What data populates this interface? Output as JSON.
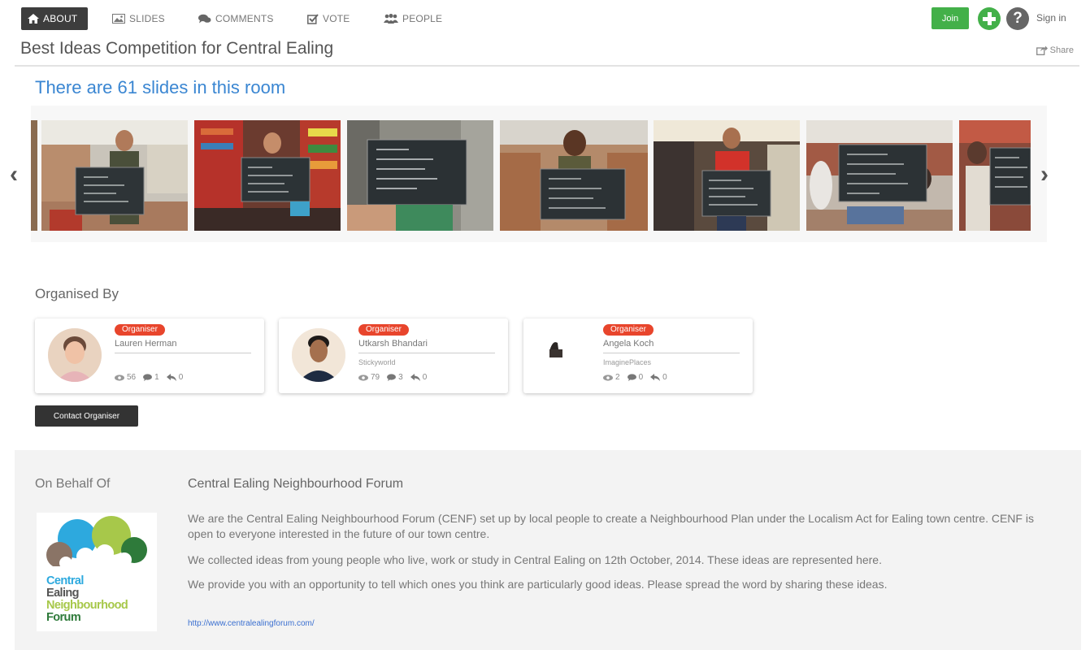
{
  "nav": {
    "tabs": [
      {
        "label": "ABOUT",
        "icon": "home-icon",
        "active": true
      },
      {
        "label": "SLIDES",
        "icon": "image-icon",
        "active": false
      },
      {
        "label": "COMMENTS",
        "icon": "comments-icon",
        "active": false
      },
      {
        "label": "VOTE",
        "icon": "checkbox-icon",
        "active": false
      },
      {
        "label": "PEOPLE",
        "icon": "people-icon",
        "active": false
      }
    ],
    "join_label": "Join",
    "help_glyph": "?",
    "signin_label": "Sign in"
  },
  "room": {
    "title": "Best Ideas Competition for Central Ealing",
    "share_label": "Share",
    "slides_count_text": "There are 61 slides in this room"
  },
  "carousel": {
    "prev_glyph": "‹",
    "next_glyph": "›"
  },
  "organised": {
    "heading": "Organised By",
    "cards": [
      {
        "badge": "Organiser",
        "name": "Lauren Herman",
        "affiliation": "",
        "views": "56",
        "comments": "1",
        "replies": "0"
      },
      {
        "badge": "Organiser",
        "name": "Utkarsh Bhandari",
        "affiliation": "Stickyworld",
        "views": "79",
        "comments": "3",
        "replies": "0"
      },
      {
        "badge": "Organiser",
        "name": "Angela Koch",
        "affiliation": "ImaginePlaces",
        "views": "2",
        "comments": "0",
        "replies": "0"
      }
    ],
    "contact_label": "Contact Organiser"
  },
  "behalf": {
    "label": "On Behalf Of",
    "logo_lines": [
      "Central",
      "Ealing",
      "Neighbourhood",
      "Forum"
    ],
    "forum_name": "Central Ealing Neighbourhood Forum",
    "paragraphs": [
      "We are the Central Ealing Neighbourhood Forum (CENF) set up by local people to create a Neighbourhood Plan under the Localism Act for Ealing town centre. CENF is open to everyone interested in the future of our town centre.",
      "We collected ideas from young people who live, work or study in Central Ealing on 12th October, 2014. These ideas are represented here.",
      "We provide you with an opportunity to tell which ones you think are particularly good ideas. Please spread the word by sharing these ideas."
    ],
    "url": "http://www.centralealingforum.com/"
  },
  "colors": {
    "accent_blue": "#3a86d2",
    "join_green": "#43b049",
    "badge_red": "#e8452c",
    "dark_button": "#333333"
  }
}
